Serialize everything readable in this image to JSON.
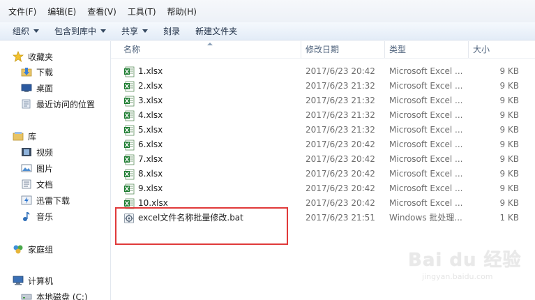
{
  "menubar": {
    "items": [
      "文件(F)",
      "编辑(E)",
      "查看(V)",
      "工具(T)",
      "帮助(H)"
    ]
  },
  "toolbar": {
    "organize": "组织",
    "include_library": "包含到库中",
    "share": "共享",
    "burn": "刻录",
    "new_folder": "新建文件夹"
  },
  "nav": {
    "favorites": "收藏夹",
    "downloads": "下载",
    "desktop": "桌面",
    "recent": "最近访问的位置",
    "libraries": "库",
    "videos": "视频",
    "pictures": "图片",
    "documents": "文档",
    "thunder": "迅雷下载",
    "music": "音乐",
    "homegroup": "家庭组",
    "computer": "计算机",
    "local_disk": "本地磁盘 (C:)"
  },
  "columns": {
    "name": "名称",
    "date": "修改日期",
    "type": "类型",
    "size": "大小"
  },
  "files": [
    {
      "name": "1.xlsx",
      "date": "2017/6/23 20:42",
      "type": "Microsoft Excel ...",
      "size": "9 KB",
      "icon": "excel"
    },
    {
      "name": "2.xlsx",
      "date": "2017/6/23 21:32",
      "type": "Microsoft Excel ...",
      "size": "9 KB",
      "icon": "excel"
    },
    {
      "name": "3.xlsx",
      "date": "2017/6/23 21:32",
      "type": "Microsoft Excel ...",
      "size": "9 KB",
      "icon": "excel"
    },
    {
      "name": "4.xlsx",
      "date": "2017/6/23 21:32",
      "type": "Microsoft Excel ...",
      "size": "9 KB",
      "icon": "excel"
    },
    {
      "name": "5.xlsx",
      "date": "2017/6/23 21:32",
      "type": "Microsoft Excel ...",
      "size": "9 KB",
      "icon": "excel"
    },
    {
      "name": "6.xlsx",
      "date": "2017/6/23 20:42",
      "type": "Microsoft Excel ...",
      "size": "9 KB",
      "icon": "excel"
    },
    {
      "name": "7.xlsx",
      "date": "2017/6/23 20:42",
      "type": "Microsoft Excel ...",
      "size": "9 KB",
      "icon": "excel"
    },
    {
      "name": "8.xlsx",
      "date": "2017/6/23 20:42",
      "type": "Microsoft Excel ...",
      "size": "9 KB",
      "icon": "excel"
    },
    {
      "name": "9.xlsx",
      "date": "2017/6/23 20:42",
      "type": "Microsoft Excel ...",
      "size": "9 KB",
      "icon": "excel"
    },
    {
      "name": "10.xlsx",
      "date": "2017/6/23 20:42",
      "type": "Microsoft Excel ...",
      "size": "9 KB",
      "icon": "excel"
    },
    {
      "name": "excel文件名称批量修改.bat",
      "date": "2017/6/23 21:51",
      "type": "Windows 批处理...",
      "size": "1 KB",
      "icon": "bat"
    }
  ],
  "watermark": {
    "main": "Bai du 经验",
    "sub": "jingyan.baidu.com"
  },
  "colors": {
    "highlight": "#e03a3a",
    "excel_green": "#1e7d32"
  }
}
